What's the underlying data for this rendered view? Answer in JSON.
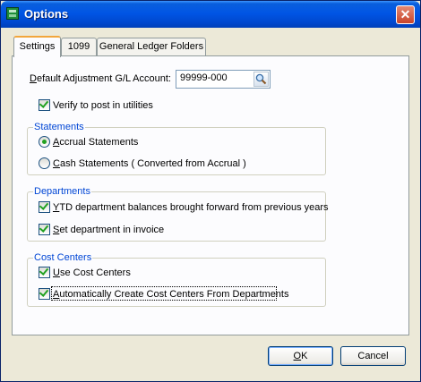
{
  "window": {
    "title": "Options",
    "close_glyph": "✕"
  },
  "tabs": [
    {
      "label": "Settings",
      "active": true
    },
    {
      "label": "1099",
      "active": false
    },
    {
      "label": "General Ledger Folders",
      "active": false
    }
  ],
  "gl_account": {
    "label_pre": "D",
    "label_post": "efault Adjustment G/L Account:",
    "value": "99999-000",
    "lookup_icon": "magnifier-icon"
  },
  "verify": {
    "label": "Verify to post in utilities",
    "checked": true
  },
  "statements": {
    "title": "Statements",
    "accrual": {
      "label_pre": "A",
      "label_post": "ccrual Statements",
      "selected": true
    },
    "cash": {
      "label_pre": "C",
      "label_post": "ash Statements ( Converted from Accrual )",
      "selected": false
    }
  },
  "departments": {
    "title": "Departments",
    "ytd": {
      "label_pre": "Y",
      "label_post": "TD department balances brought forward from previous years",
      "checked": true
    },
    "set_dept": {
      "label_pre": "S",
      "label_post": "et department in invoice",
      "checked": true
    }
  },
  "cost_centers": {
    "title": "Cost Centers",
    "use": {
      "label_pre": "U",
      "label_post": "se Cost Centers",
      "checked": true
    },
    "auto_create": {
      "label_pre": "A",
      "label_post": "utomatically Create Cost Centers From Departments",
      "checked": true
    }
  },
  "buttons": {
    "ok": {
      "label_pre": "O",
      "label_post": "K"
    },
    "cancel": {
      "label": "Cancel"
    }
  },
  "colors": {
    "titlebar": "#0055e5",
    "group_title": "#0046d5",
    "check": "#21a121"
  }
}
